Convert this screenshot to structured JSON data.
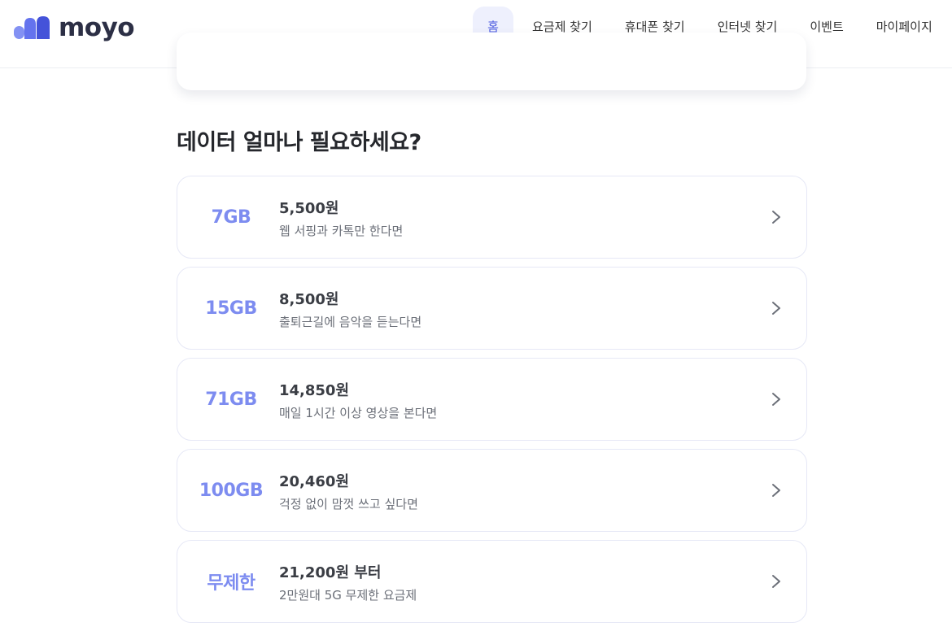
{
  "header": {
    "logo_text": "moyo",
    "nav": [
      {
        "label": "홈",
        "active": true
      },
      {
        "label": "요금제 찾기"
      },
      {
        "label": "휴대폰 찾기"
      },
      {
        "label": "인터넷 찾기"
      },
      {
        "label": "이벤트"
      },
      {
        "label": "마이페이지"
      }
    ]
  },
  "section": {
    "title": "데이터 얼마나 필요하세요?"
  },
  "plans": [
    {
      "size": "7GB",
      "price": "5,500원",
      "desc": "웹 서핑과 카톡만 한다면"
    },
    {
      "size": "15GB",
      "price": "8,500원",
      "desc": "출퇴근길에 음악을 듣는다면"
    },
    {
      "size": "71GB",
      "price": "14,850원",
      "desc": "매일 1시간 이상 영상을 본다면"
    },
    {
      "size": "100GB",
      "price": "20,460원",
      "desc": "걱정 없이 맘껏 쓰고 싶다면"
    },
    {
      "size": "무제한",
      "price": "21,200원 부터",
      "desc": "2만원대 5G 무제한 요금제"
    }
  ],
  "colors": {
    "brand": "#4e5de0",
    "size_accent": "#7d8cf0",
    "nav_active_bg": "#eef0fd"
  },
  "icons": {
    "logo": "moyo-logo-mark",
    "plan_arrow": "chevron-right-icon"
  }
}
